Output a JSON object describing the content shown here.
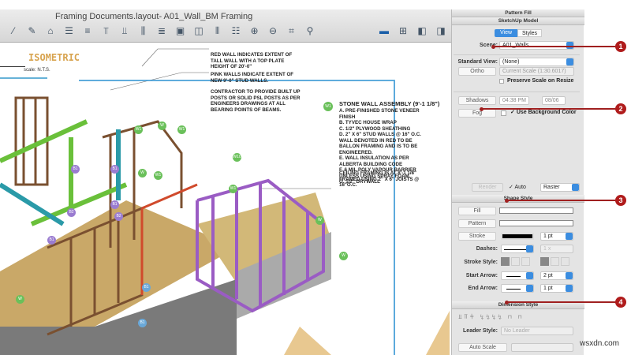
{
  "window": {
    "title": "Framing Documents.layout- A01_Wall_BM Framing"
  },
  "toolbar": {
    "icons": [
      "eyedropper-icon",
      "pen-icon",
      "paint-icon",
      "align-left-icon",
      "align-center-icon",
      "align-top-icon",
      "align-bottom-icon",
      "distribute-h-icon",
      "distribute-v-icon",
      "group-icon",
      "ungroup-icon",
      "space-h-icon",
      "space-v-icon",
      "zoom-in-icon",
      "zoom-out-icon",
      "zoom-fit-icon",
      "magnifier-icon"
    ],
    "right_icons": [
      "presentation-icon",
      "add-page-icon",
      "prev-page-icon",
      "next-page-icon"
    ]
  },
  "drawing": {
    "title": "ISOMETRIC",
    "scale": "scale: N.T.S.",
    "notes": [
      "RED WALL INDICATES EXTENT OF TALL WALL WITH A TOP PLATE HEIGHT OF 20'-0\"",
      "PINK WALLS INDICATE EXTENT OF NEW 9'-0\" STUD WALLS.",
      "CONTRACTOR TO PROVIDE BUILT UP POSTS OR SOLID PSL POSTS AS PER ENGINEERS DRAWINGS AT ALL BEARING POINTS OF BEAMS."
    ],
    "assembly_title": "STONE WALL ASSEMBLY (9'-1 1/8\")",
    "assembly_items": [
      "A. PRE-FINISHED STONE VENEER FINISH",
      "B. TYVEC HOUSE WRAP",
      "C. 1/2\" PLYWOOD SHEATHING",
      "D. 2\" X 6\" STUD WALLS @ 16\" O.C. WALL DENOTED IN RED TO BE BALLON FRAMING AND IS TO BE ENGINEERED.",
      "E. WALL INSULATION AS PER ALBERTA BUILDING CODE",
      "F. 6 MIL POLY VAPOUR BARRIER UNLESS USING SPRAY FOAM.",
      "G. 1/2\" DRYWALL"
    ],
    "ceiling_note": "CEILING FRAMING IS AT 8'-1 1/8\" FRAMED USING 2\" X 6\" JOISTS @ 16\"O.C.",
    "tags": [
      "W1",
      "W",
      "W1",
      "W10",
      "W",
      "W1",
      "W1",
      "B1",
      "B1",
      "B2",
      "B1",
      "B1",
      "B2",
      "B1",
      "B1",
      "W",
      "W",
      "W"
    ]
  },
  "panel": {
    "pattern_fill": "Pattern Fill",
    "sketchup_model": "SketchUp Model",
    "tabs": [
      "View",
      "Styles"
    ],
    "scene_label": "Scene:",
    "scene_value": "A01_Walls",
    "standard_view_label": "Standard View:",
    "standard_view_value": "(None)",
    "ortho": "Ortho",
    "scale_value": "Current Scale (1:30.6017)",
    "preserve": "Preserve Scale on Resize",
    "shadows": "Shadows",
    "time": "04:38 PM",
    "date": "08/06",
    "fog": "Fog",
    "use_bg": "Use Background Color",
    "render": "Render",
    "auto": "Auto",
    "render_mode": "Raster",
    "shape_style": "Shape Style",
    "fill": "Fill",
    "pattern": "Pattern",
    "stroke": "Stroke",
    "stroke_width": "1 pt",
    "dashes_label": "Dashes:",
    "dash_scale": "1 x",
    "stroke_style_label": "Stroke Style:",
    "start_arrow_label": "Start Arrow:",
    "start_arrow_size": "2 pt",
    "end_arrow_label": "End Arrow:",
    "end_arrow_size": "1 pt",
    "dimension_style": "Dimension Style",
    "leader_label": "Leader Style:",
    "leader_value": "No Leader",
    "auto_scale": "Auto Scale"
  },
  "callouts": [
    "1",
    "2",
    "3",
    "4"
  ],
  "watermark": "wsxdn.com",
  "colors": {
    "accent": "#3b8de0",
    "callout": "#b01c1c"
  }
}
